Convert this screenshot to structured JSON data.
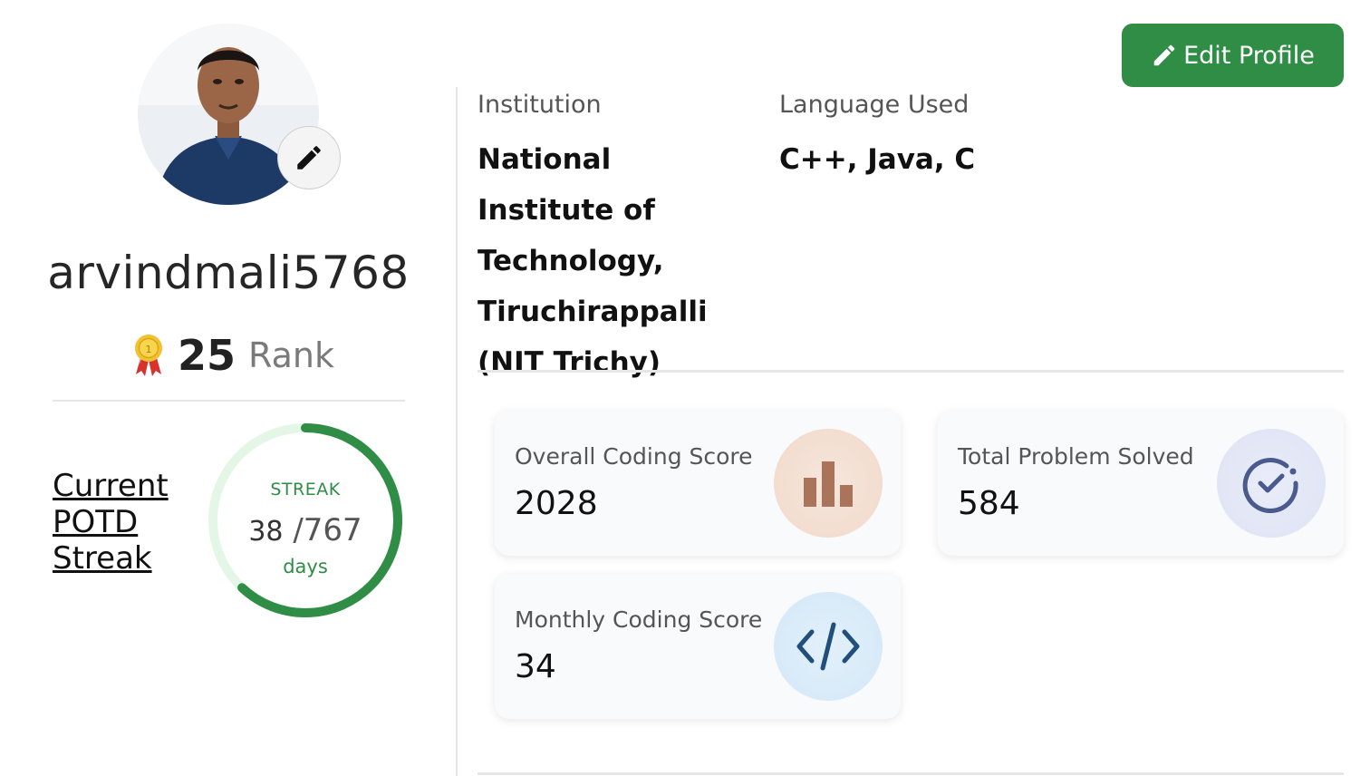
{
  "profile": {
    "username": "arvindmali5768",
    "rank_value": "25",
    "rank_label": "Rank"
  },
  "streak": {
    "link_lines": [
      "Current",
      "POTD",
      "Streak"
    ],
    "label": "STREAK",
    "current": "38",
    "total": "/767",
    "unit": "days",
    "progress_fraction": 0.62
  },
  "header": {
    "edit_profile_label": "Edit Profile"
  },
  "info": {
    "institution_label": "Institution",
    "institution_value": "National Institute of Technology, Tiruchirappalli (NIT Trichy)",
    "language_label": "Language Used",
    "language_value": "C++, Java, C"
  },
  "stats": {
    "overall": {
      "title": "Overall Coding Score",
      "value": "2028",
      "icon": "bar-chart-icon"
    },
    "solved": {
      "title": "Total Problem Solved",
      "value": "584",
      "icon": "check-circle-icon"
    },
    "monthly": {
      "title": "Monthly Coding Score",
      "value": "34",
      "icon": "code-icon"
    }
  },
  "colors": {
    "accent_green": "#2f8d46",
    "ring_track": "#e4f7e6",
    "overall_icon_bg": "#f3ddd0",
    "overall_icon_fg": "#a9745a",
    "solved_icon_bg": "#dfe4f5",
    "solved_icon_fg": "#4b5a8e",
    "monthly_icon_bg": "#d6e9f8",
    "monthly_icon_fg": "#1f4f7a"
  }
}
